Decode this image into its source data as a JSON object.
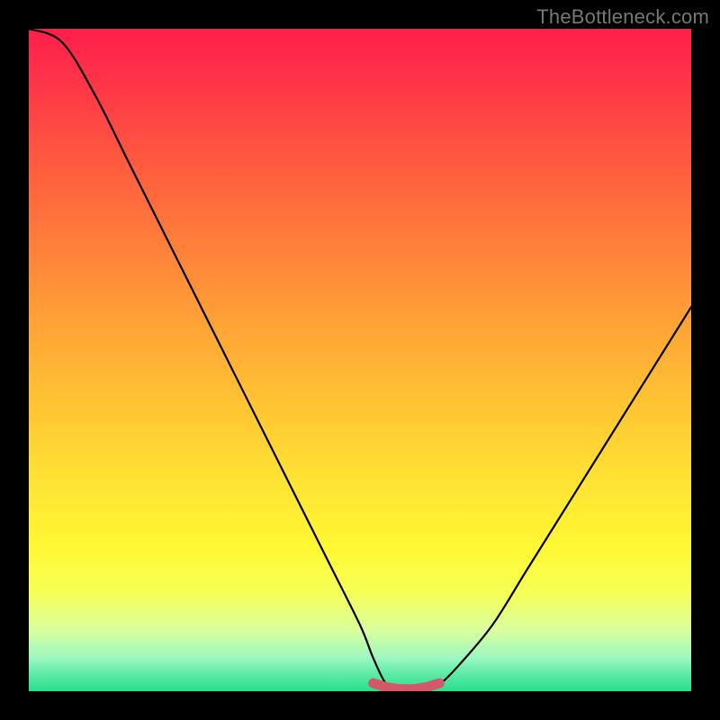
{
  "source_label": "TheBottleneck.com",
  "colors": {
    "curve": "#000000",
    "marker": "#d1596a",
    "frame": "#000000"
  },
  "chart_data": {
    "type": "line",
    "title": "",
    "xlabel": "",
    "ylabel": "",
    "xlim": [
      0,
      100
    ],
    "ylim": [
      0,
      100
    ],
    "series": [
      {
        "name": "bottleneck-curve",
        "x": [
          0,
          5,
          10,
          15,
          20,
          25,
          30,
          35,
          40,
          45,
          50,
          52,
          54,
          56,
          58,
          60,
          62,
          65,
          70,
          75,
          80,
          85,
          90,
          95,
          100
        ],
        "y": [
          100,
          98,
          90,
          80,
          70,
          60,
          50,
          40,
          30,
          20,
          10,
          5,
          1,
          0,
          0,
          0,
          1,
          4,
          10,
          18,
          26,
          34,
          42,
          50,
          58
        ]
      }
    ],
    "flat_marker": {
      "x": [
        52,
        54,
        56,
        58,
        60,
        62
      ],
      "y": [
        1.2,
        0.6,
        0.3,
        0.3,
        0.6,
        1.2
      ]
    }
  }
}
